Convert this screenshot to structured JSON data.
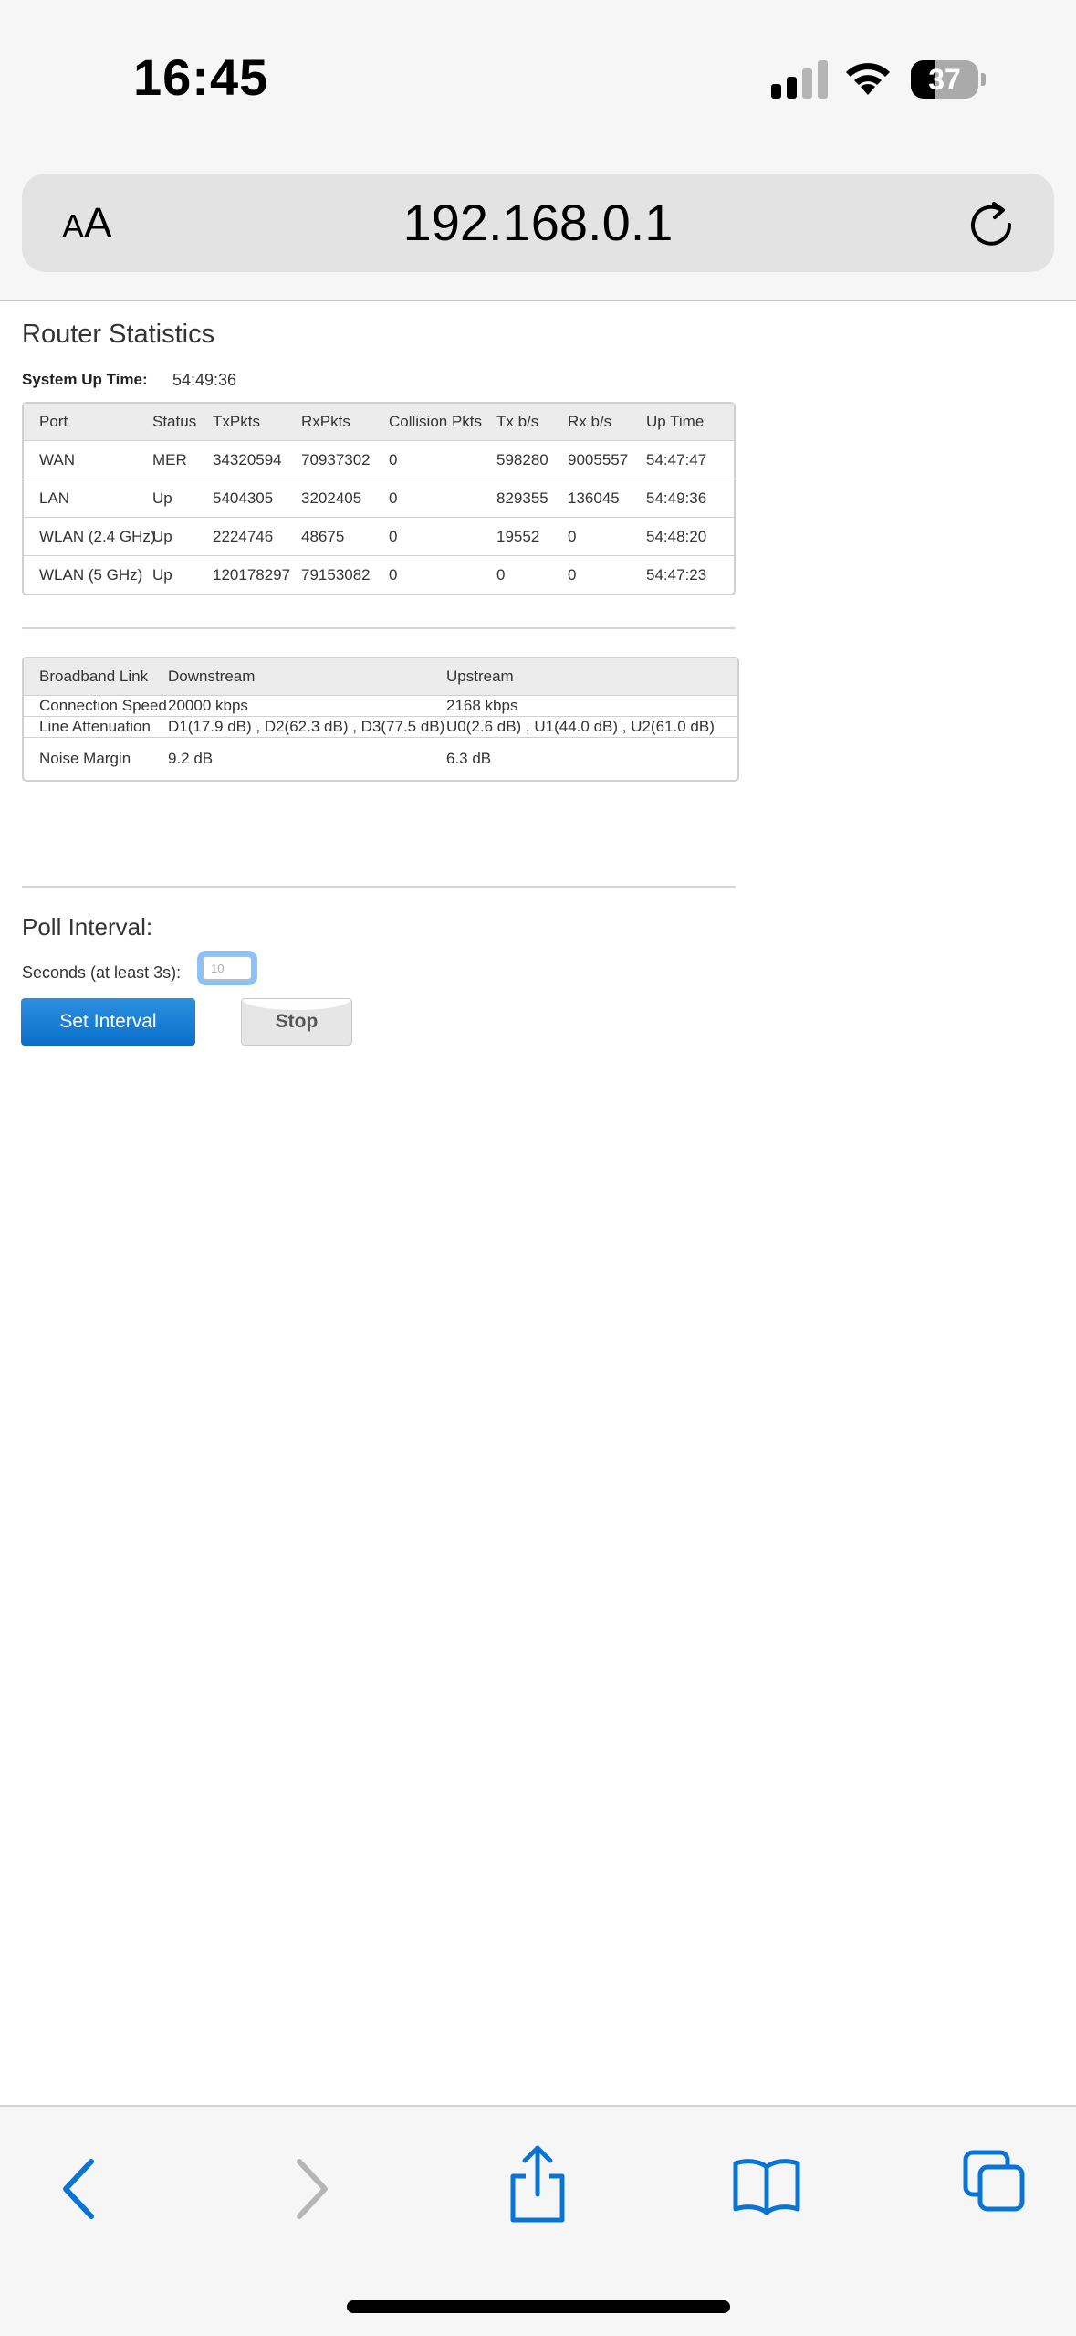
{
  "status_bar": {
    "time": "16:45",
    "battery_level": "37",
    "battery_fraction": 0.37
  },
  "browser": {
    "text_size_label_small": "A",
    "text_size_label_large": "A",
    "url": "192.168.0.1",
    "accent_color": "#0a74d4"
  },
  "page": {
    "title": "Router Statistics",
    "uptime_label": "System Up Time:",
    "uptime_value": "54:49:36",
    "stats_table": {
      "headers": [
        "Port",
        "Status",
        "TxPkts",
        "RxPkts",
        "Collision Pkts",
        "Tx b/s",
        "Rx b/s",
        "Up Time"
      ],
      "rows": [
        [
          "WAN",
          "MER",
          "34320594",
          "70937302",
          "0",
          "598280",
          "9005557",
          "54:47:47"
        ],
        [
          "LAN",
          "Up",
          "5404305",
          "3202405",
          "0",
          "829355",
          "136045",
          "54:49:36"
        ],
        [
          "WLAN (2.4 GHz)",
          "Up",
          "2224746",
          "48675",
          "0",
          "19552",
          "0",
          "54:48:20"
        ],
        [
          "WLAN (5 GHz)",
          "Up",
          "120178297",
          "79153082",
          "0",
          "0",
          "0",
          "54:47:23"
        ]
      ]
    },
    "broadband_table": {
      "headers": [
        "Broadband Link",
        "Downstream",
        "Upstream"
      ],
      "rows": [
        [
          "Connection Speed",
          "20000 kbps",
          "2168 kbps"
        ],
        [
          "Line Attenuation",
          "D1(17.9 dB) , D2(62.3 dB) , D3(77.5 dB)",
          "U0(2.6 dB) , U1(44.0 dB) , U2(61.0 dB)"
        ],
        [
          "Noise Margin",
          "9.2 dB",
          "6.3 dB"
        ]
      ]
    },
    "poll": {
      "title": "Poll Interval:",
      "seconds_label": "Seconds (at least 3s):",
      "input_value": "",
      "input_placeholder": "10",
      "set_button": "Set Interval",
      "stop_button": "Stop"
    }
  },
  "toolbar": {
    "icons": [
      "back-icon",
      "forward-icon",
      "share-icon",
      "bookmarks-icon",
      "tabs-icon"
    ]
  }
}
